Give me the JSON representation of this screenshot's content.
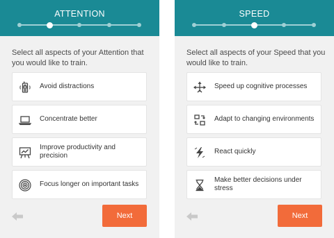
{
  "colors": {
    "header": "#1a8a95",
    "background": "#f1f1f1",
    "next_button": "#f26b3a",
    "icon": "#444444",
    "back_arrow": "#c9c9c9"
  },
  "screens": [
    {
      "title": "ATTENTION",
      "prompt": "Select all aspects of your Attention that you would like to train.",
      "progress": {
        "total_steps": 5,
        "current_step": 2
      },
      "options": [
        {
          "label": "Avoid distractions",
          "icon": "phone-icon"
        },
        {
          "label": "Concentrate better",
          "icon": "laptop-icon"
        },
        {
          "label": "Improve productivity and precision",
          "icon": "presentation-chart-icon"
        },
        {
          "label": "Focus longer on important tasks",
          "icon": "target-icon"
        }
      ],
      "next_label": "Next",
      "back_icon": "back-arrow-icon"
    },
    {
      "title": "SPEED",
      "prompt": "Select all aspects of your Speed that you would like to train.",
      "progress": {
        "total_steps": 5,
        "current_step": 3
      },
      "options": [
        {
          "label": "Speed up cognitive processes",
          "icon": "expand-arrows-icon"
        },
        {
          "label": "Adapt to changing environments",
          "icon": "switch-arrows-icon"
        },
        {
          "label": "React quickly",
          "icon": "lightning-icon"
        },
        {
          "label": "Make better decisions under stress",
          "icon": "hourglass-icon"
        }
      ],
      "next_label": "Next",
      "back_icon": "back-arrow-icon"
    }
  ]
}
